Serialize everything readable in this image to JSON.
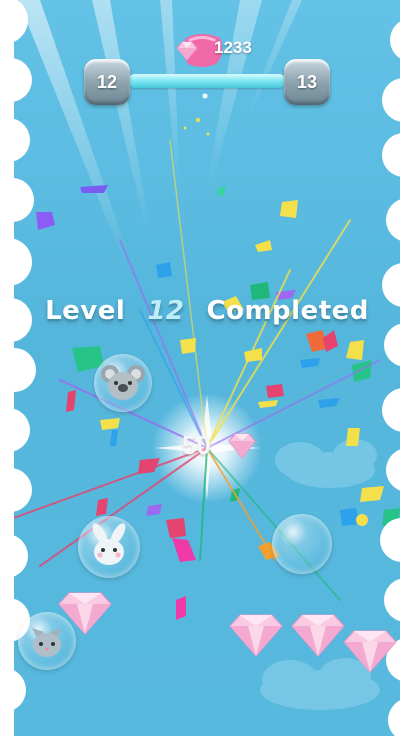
{
  "hud": {
    "gem_count": "1233",
    "current_level": "12",
    "next_level": "13",
    "progress": 1.0
  },
  "banner": {
    "word_level": "Level",
    "level_number": "12",
    "word_completed": "Completed"
  },
  "reward": {
    "amount": "50"
  },
  "colors": {
    "sky": "#57b8dc",
    "track": "#7ee6f2",
    "gem_pink": "#f4a9d0",
    "jelly_pink": "#f06aa8"
  },
  "icons": {
    "gem": "diamond-icon",
    "jelly": "pink-jelly-icon",
    "koala": "koala-bubble",
    "bunny": "bunny-bubble",
    "cat": "cat-bubble"
  }
}
